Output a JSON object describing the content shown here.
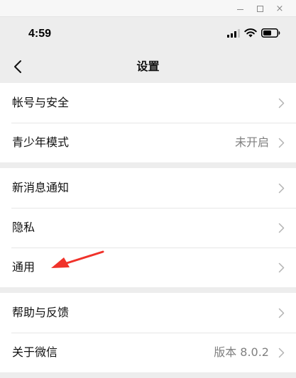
{
  "window": {
    "close_glyph": "×"
  },
  "status_bar": {
    "time": "4:59"
  },
  "nav": {
    "title": "设置"
  },
  "groups": [
    {
      "items": [
        {
          "label": "帐号与安全",
          "value": ""
        },
        {
          "label": "青少年模式",
          "value": "未开启"
        }
      ]
    },
    {
      "items": [
        {
          "label": "新消息通知",
          "value": ""
        },
        {
          "label": "隐私",
          "value": ""
        },
        {
          "label": "通用",
          "value": ""
        }
      ]
    },
    {
      "items": [
        {
          "label": "帮助与反馈",
          "value": ""
        },
        {
          "label": "关于微信",
          "value": "版本 8.0.2"
        }
      ]
    }
  ],
  "colors": {
    "background": "#ededed",
    "surface": "#ffffff",
    "annotation_arrow": "#f0322a"
  },
  "icons": [
    "chevron-left-icon",
    "chevron-right-icon",
    "signal-icon",
    "wifi-icon",
    "battery-icon",
    "minimize-icon",
    "maximize-icon",
    "close-icon"
  ]
}
